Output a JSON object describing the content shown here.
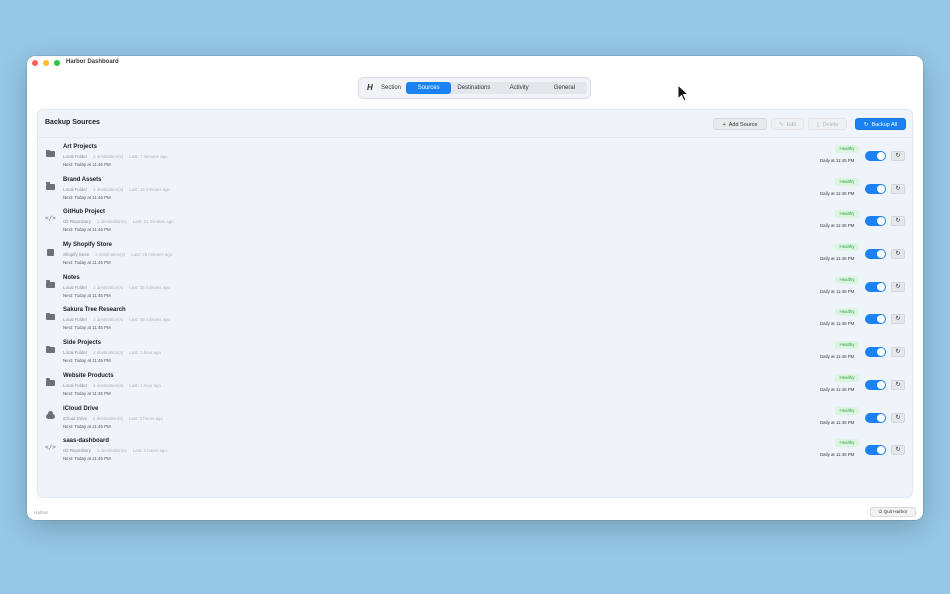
{
  "window": {
    "title": "Harbor Dashboard"
  },
  "nav": {
    "logo": "H",
    "section_label": "Section",
    "tabs": [
      "Sources",
      "Destinations",
      "Activity",
      "General"
    ],
    "active_tab": "Sources"
  },
  "panel": {
    "title": "Backup Sources",
    "add_label": "Add Source",
    "edit_label": "Edit",
    "delete_label": "Delete",
    "backup_all_label": "Backup All"
  },
  "sources": [
    {
      "name": "Art Projects",
      "type": "Local Folder",
      "destinations": "2 destination(s)",
      "last": "Last: 7 minutes ago",
      "next": "Next: Today at 11:45 PM",
      "status": "Healthy",
      "schedule": "Daily at 11:45 PM",
      "icon": "folder-icon",
      "enabled": true
    },
    {
      "name": "Brand Assets",
      "type": "Local Folder",
      "destinations": "1 destination(s)",
      "last": "Last: 14 minutes ago",
      "next": "Next: Today at 11:45 PM",
      "status": "Healthy",
      "schedule": "Daily at 11:45 PM",
      "icon": "folder-icon",
      "enabled": true
    },
    {
      "name": "GitHub Project",
      "type": "Git Repository",
      "destinations": "1 destination(s)",
      "last": "Last: 21 minutes ago",
      "next": "Next: Today at 11:45 PM",
      "status": "Healthy",
      "schedule": "Daily at 11:45 PM",
      "icon": "code-icon",
      "enabled": true
    },
    {
      "name": "My Shopify Store",
      "type": "Shopify Store",
      "destinations": "2 destination(s)",
      "last": "Last: 28 minutes ago",
      "next": "Next: Today at 11:45 PM",
      "status": "Healthy",
      "schedule": "Daily at 11:45 PM",
      "icon": "shopping-bag-icon",
      "enabled": true
    },
    {
      "name": "Notes",
      "type": "Local Folder",
      "destinations": "1 destination(s)",
      "last": "Last: 35 minutes ago",
      "next": "Next: Today at 11:45 PM",
      "status": "Healthy",
      "schedule": "Daily at 11:45 PM",
      "icon": "folder-icon",
      "enabled": true
    },
    {
      "name": "Sakura Tree Research",
      "type": "Local Folder",
      "destinations": "1 destination(s)",
      "last": "Last: 49 minutes ago",
      "next": "Next: Today at 11:45 PM",
      "status": "Healthy",
      "schedule": "Daily at 11:45 PM",
      "icon": "folder-icon",
      "enabled": true
    },
    {
      "name": "Side Projects",
      "type": "Local Folder",
      "destinations": "2 destination(s)",
      "last": "Last: 1 hour ago",
      "next": "Next: Today at 11:45 PM",
      "status": "Healthy",
      "schedule": "Daily at 11:45 PM",
      "icon": "folder-icon",
      "enabled": true
    },
    {
      "name": "Website Products",
      "type": "Local Folder",
      "destinations": "1 destination(s)",
      "last": "Last: 1 hour ago",
      "next": "Next: Today at 11:45 PM",
      "status": "Healthy",
      "schedule": "Daily at 11:45 PM",
      "icon": "folder-icon",
      "enabled": true
    },
    {
      "name": "iCloud Drive",
      "type": "iCloud Drive",
      "destinations": "2 destination(s)",
      "last": "Last: 2 hours ago",
      "next": "Next: Today at 11:45 PM",
      "status": "Healthy",
      "schedule": "Daily at 11:45 PM",
      "icon": "cloud-icon",
      "enabled": true
    },
    {
      "name": "saas-dashboard",
      "type": "Git Repository",
      "destinations": "1 destination(s)",
      "last": "Last: 2 hours ago",
      "next": "Next: Today at 11:45 PM",
      "status": "Healthy",
      "schedule": "Daily at 11:45 PM",
      "icon": "code-icon",
      "enabled": true
    }
  ],
  "footer": {
    "app_name": "Harbor",
    "quit_label": "Quit Harbor"
  },
  "colors": {
    "accent": "#1a82f4",
    "healthy_bg": "#dcf5e1",
    "healthy_text": "#2fa34a",
    "desktop": "#95c8e6"
  }
}
